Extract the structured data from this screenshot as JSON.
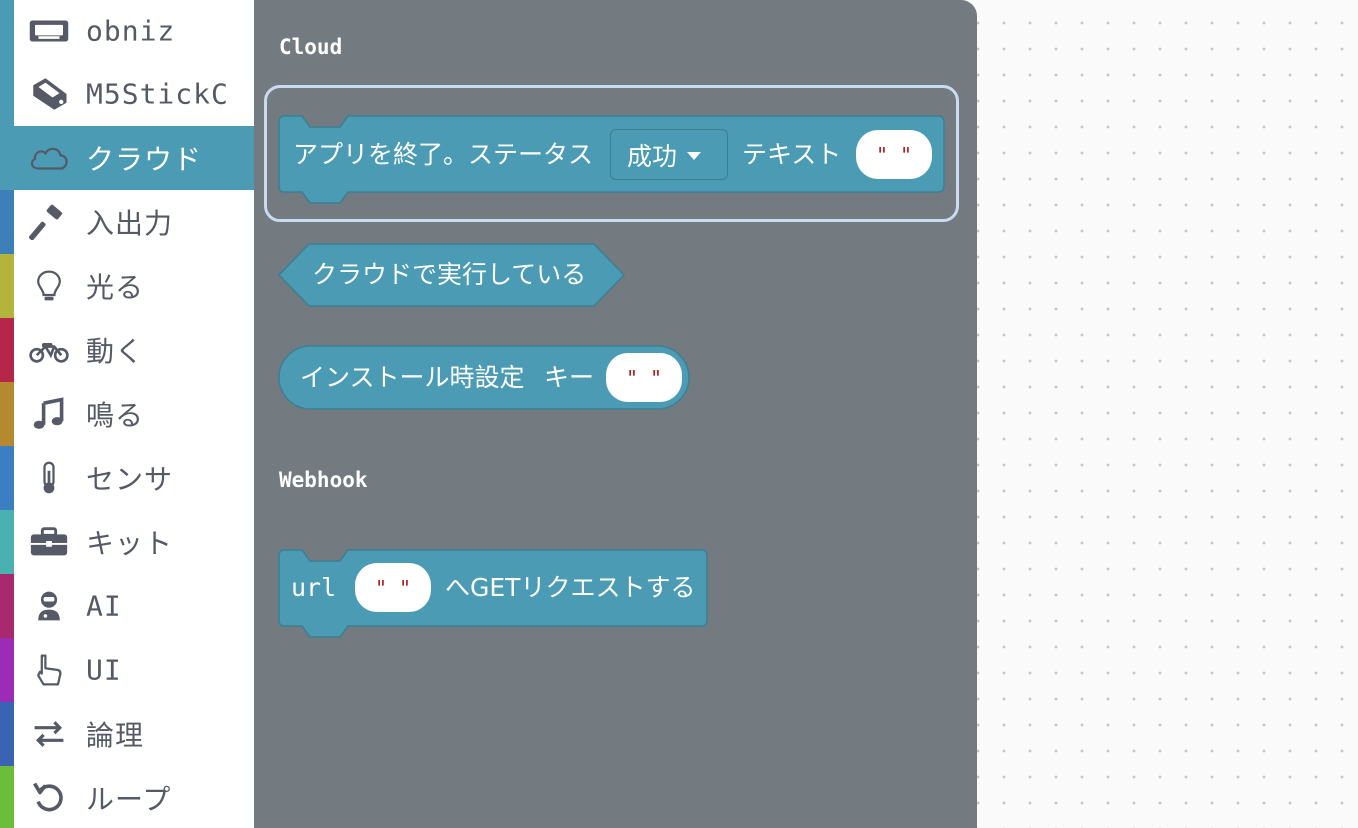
{
  "categories": [
    {
      "label": "obniz",
      "icon": "obniz-board-icon",
      "stripe": "#4a9bb3"
    },
    {
      "label": "M5StickC",
      "icon": "m5stickc-device-icon",
      "stripe": "#4a9bb3"
    },
    {
      "label": "クラウド",
      "icon": "cloud-icon",
      "stripe": "#4a9bb3",
      "selected": true
    },
    {
      "label": "入出力",
      "icon": "hammer-icon",
      "stripe": "#3d7fb8"
    },
    {
      "label": "光る",
      "icon": "lightbulb-icon",
      "stripe": "#b3b43a"
    },
    {
      "label": "動く",
      "icon": "motorcycle-icon",
      "stripe": "#b5264a"
    },
    {
      "label": "鳴る",
      "icon": "music-note-icon",
      "stripe": "#b58a2f"
    },
    {
      "label": "センサ",
      "icon": "thermometer-icon",
      "stripe": "#3b7fc0"
    },
    {
      "label": "キット",
      "icon": "toolbox-icon",
      "stripe": "#4bb0b0"
    },
    {
      "label": "AI",
      "icon": "robot-icon",
      "stripe": "#a8296e"
    },
    {
      "label": "UI",
      "icon": "pointer-hand-icon",
      "stripe": "#9b2cb5"
    },
    {
      "label": "論理",
      "icon": "swap-arrows-icon",
      "stripe": "#3a63b3"
    },
    {
      "label": "ループ",
      "icon": "loop-arrow-icon",
      "stripe": "#6bbd3a"
    }
  ],
  "flyout": {
    "sections": {
      "cloud": "Cloud",
      "webhook": "Webhook"
    },
    "blocks": {
      "exit_app": {
        "prefix": "アプリを終了。ステータス",
        "dropdown_value": "成功",
        "middle": "テキスト",
        "string_value": "\"   \""
      },
      "running_on_cloud": {
        "label": "クラウドで実行している"
      },
      "install_setting": {
        "label": "インストール時設定",
        "key_label": "キー",
        "string_value": "\"   \""
      },
      "get_request": {
        "prefix": "url",
        "string_value": "\"   \"",
        "suffix": "へGETリクエストする"
      }
    }
  },
  "colors": {
    "block": "#4a9bb3",
    "block_border": "#3b7f93",
    "flyout_bg": "#737a80",
    "highlight": "#c9dbf3",
    "string_quote": "#b21d1d"
  }
}
